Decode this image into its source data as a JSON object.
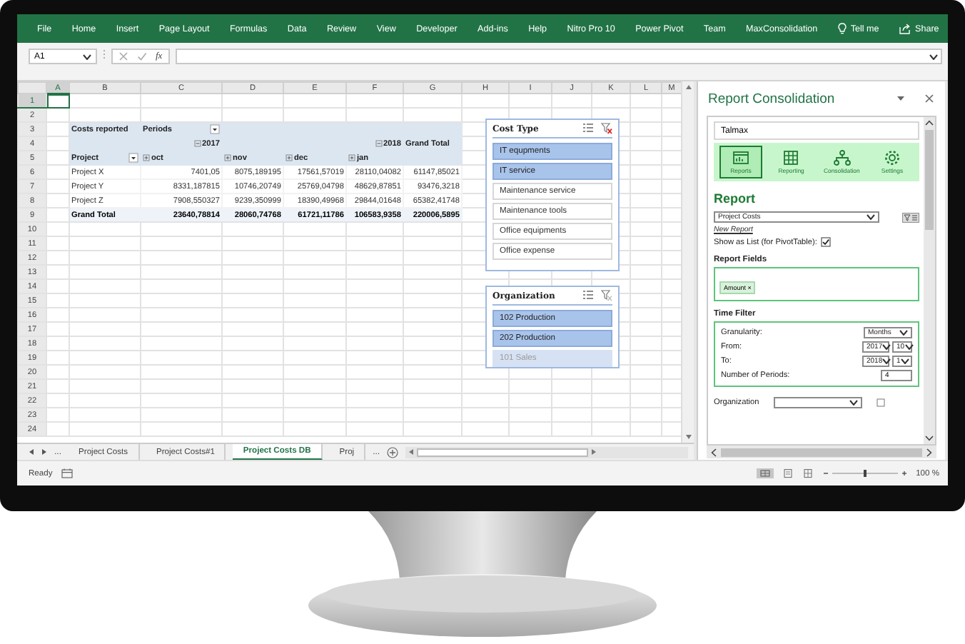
{
  "ribbon": {
    "tabs": [
      {
        "label": "File"
      },
      {
        "label": "Home"
      },
      {
        "label": "Insert"
      },
      {
        "label": "Page Layout"
      },
      {
        "label": "Formulas"
      },
      {
        "label": "Data"
      },
      {
        "label": "Review"
      },
      {
        "label": "View"
      },
      {
        "label": "Developer"
      },
      {
        "label": "Add-ins"
      },
      {
        "label": "Help"
      },
      {
        "label": "Nitro Pro 10"
      },
      {
        "label": "Power Pivot"
      },
      {
        "label": "Team"
      },
      {
        "label": "MaxConsolidation"
      }
    ],
    "tell_me": "Tell me",
    "share": "Share"
  },
  "formula_bar": {
    "name_box": "A1",
    "fx": "fx"
  },
  "sheet": {
    "columns": [
      {
        "label": "A",
        "selected": true
      },
      {
        "label": "B",
        "selected": false
      },
      {
        "label": "C",
        "selected": false
      },
      {
        "label": "D",
        "selected": false
      },
      {
        "label": "E",
        "selected": false
      },
      {
        "label": "F",
        "selected": false
      },
      {
        "label": "G",
        "selected": false
      },
      {
        "label": "H",
        "selected": false
      },
      {
        "label": "I",
        "selected": false
      },
      {
        "label": "J",
        "selected": false
      },
      {
        "label": "K",
        "selected": false
      },
      {
        "label": "L",
        "selected": false
      },
      {
        "label": "M",
        "selected": false
      }
    ],
    "rows": [
      {
        "label": "1",
        "selected": true
      },
      {
        "label": "2",
        "selected": false
      },
      {
        "label": "3",
        "selected": false
      },
      {
        "label": "4",
        "selected": false
      },
      {
        "label": "5",
        "selected": false
      },
      {
        "label": "6",
        "selected": false
      },
      {
        "label": "7",
        "selected": false
      },
      {
        "label": "8",
        "selected": false
      },
      {
        "label": "9",
        "selected": false
      },
      {
        "label": "10",
        "selected": false
      },
      {
        "label": "11",
        "selected": false
      },
      {
        "label": "12",
        "selected": false
      },
      {
        "label": "13",
        "selected": false
      },
      {
        "label": "14",
        "selected": false
      },
      {
        "label": "15",
        "selected": false
      },
      {
        "label": "16",
        "selected": false
      },
      {
        "label": "17",
        "selected": false
      },
      {
        "label": "18",
        "selected": false
      },
      {
        "label": "19",
        "selected": false
      },
      {
        "label": "20",
        "selected": false
      },
      {
        "label": "21",
        "selected": false
      },
      {
        "label": "22",
        "selected": false
      },
      {
        "label": "23",
        "selected": false
      },
      {
        "label": "24",
        "selected": false
      }
    ]
  },
  "pivot": {
    "rows": [
      {
        "kind": "title",
        "cells": [
          {
            "text": "Costs reported"
          },
          {
            "text": "Periods",
            "has_filter": true
          },
          null,
          null,
          null,
          null
        ]
      },
      {
        "kind": "title",
        "cells": [
          null,
          {
            "text": "2017",
            "expanded": true
          },
          null,
          null,
          {
            "text": "2018",
            "expanded": true
          },
          {
            "text": "Grand Total"
          }
        ]
      },
      {
        "kind": "title",
        "cells": [
          {
            "text": "Project",
            "has_filter": true
          },
          {
            "text": "oct",
            "expanded": false
          },
          {
            "text": "nov",
            "expanded": false
          },
          {
            "text": "dec",
            "expanded": false
          },
          {
            "text": "jan",
            "expanded": false
          },
          null
        ]
      },
      {
        "kind": "data",
        "cells": [
          {
            "text": "Project X"
          },
          {
            "text": "7401,05"
          },
          {
            "text": "8075,189195"
          },
          {
            "text": "17561,57019"
          },
          {
            "text": "28110,04082"
          },
          {
            "text": "61147,85021"
          }
        ]
      },
      {
        "kind": "data",
        "cells": [
          {
            "text": "Project Y"
          },
          {
            "text": "8331,187815"
          },
          {
            "text": "10746,20749"
          },
          {
            "text": "25769,04798"
          },
          {
            "text": "48629,87851"
          },
          {
            "text": "93476,3218"
          }
        ]
      },
      {
        "kind": "data",
        "cells": [
          {
            "text": "Project Z"
          },
          {
            "text": "7908,550327"
          },
          {
            "text": "9239,350999"
          },
          {
            "text": "18390,49968"
          },
          {
            "text": "29844,01648"
          },
          {
            "text": "65382,41748"
          }
        ]
      },
      {
        "kind": "total",
        "cells": [
          {
            "text": "Grand Total"
          },
          {
            "text": "23640,78814"
          },
          {
            "text": "28060,74768"
          },
          {
            "text": "61721,11786"
          },
          {
            "text": "106583,9358"
          },
          {
            "text": "220006,5895"
          }
        ]
      }
    ]
  },
  "slicers": [
    {
      "title": "Cost Type",
      "clear_enabled": true,
      "items": [
        {
          "label": "IT equpments",
          "selected": true,
          "has_data": true
        },
        {
          "label": "IT service",
          "selected": true,
          "has_data": true
        },
        {
          "label": "Maintenance service",
          "selected": false,
          "has_data": true
        },
        {
          "label": "Maintenance tools",
          "selected": false,
          "has_data": true
        },
        {
          "label": "Office equipments",
          "selected": false,
          "has_data": true
        },
        {
          "label": "Office expense",
          "selected": false,
          "has_data": true
        }
      ]
    },
    {
      "title": "Organization",
      "clear_enabled": false,
      "items": [
        {
          "label": "102 Production",
          "selected": true,
          "has_data": true
        },
        {
          "label": "202 Production",
          "selected": true,
          "has_data": true
        },
        {
          "label": "101 Sales",
          "selected": true,
          "has_data": false
        }
      ]
    }
  ],
  "sheet_tabs": {
    "more": "...",
    "tabs": [
      {
        "label": "Project Costs",
        "selected": false
      },
      {
        "label": "Project Costs#1",
        "selected": false
      },
      {
        "label": "Project Costs DB",
        "selected": true
      },
      {
        "label": "Proj",
        "selected": false
      }
    ],
    "overflow": "..."
  },
  "status_bar": {
    "text": "Ready",
    "zoom_slider": {
      "level": 0.5
    },
    "zoom": "100 %"
  },
  "panel": {
    "title": "Report Consolidation",
    "company": "Talmax",
    "toolbar": [
      {
        "label": "Reports",
        "kind": "report",
        "selected": true
      },
      {
        "label": "Reporting",
        "kind": "grid",
        "selected": false
      },
      {
        "label": "Consolidation",
        "kind": "hierarchy",
        "selected": false
      },
      {
        "label": "Settings",
        "kind": "gear",
        "selected": false
      }
    ],
    "heading": "Report",
    "report": "Project Costs",
    "new_report": "New Report",
    "show_as_list": {
      "label": "Show as List (for PivotTable):",
      "checked": true
    },
    "fields_heading": "Report Fields",
    "fields": [
      {
        "label": "Amount",
        "remove": "×"
      }
    ],
    "time_heading": "Time Filter",
    "time_filter": [
      {
        "label": "Granularity:",
        "kind": "select",
        "values": [
          "Months"
        ]
      },
      {
        "label": "From:",
        "kind": "pair",
        "values": [
          "2017",
          "10"
        ]
      },
      {
        "label": "To:",
        "kind": "pair",
        "values": [
          "2018",
          "1"
        ]
      },
      {
        "label": "Number of Periods:",
        "kind": "input",
        "values": [
          "4"
        ]
      }
    ],
    "organization": {
      "label": "Organization",
      "checked": false
    }
  }
}
